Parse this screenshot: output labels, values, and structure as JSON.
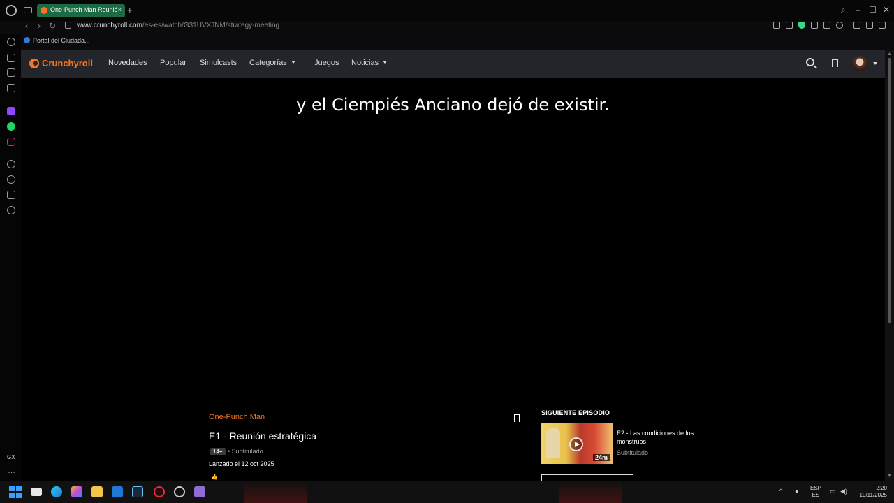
{
  "browser": {
    "tab": {
      "title": "One-Punch Man Reunión"
    },
    "address": {
      "host": "www.crunchyroll.com",
      "path": "/es-es/watch/G31UVXJNM/strategy-meeting"
    },
    "bookmarks": [
      {
        "label": "Portal del Ciudada..."
      }
    ],
    "sidebar": {
      "gx_label": "GX",
      "more_label": "…"
    }
  },
  "site": {
    "logo": "Crunchyroll",
    "brand_color": "#f47521",
    "nav": [
      {
        "label": "Novedades"
      },
      {
        "label": "Popular"
      },
      {
        "label": "Simulcasts"
      },
      {
        "label": "Categorías"
      },
      {
        "label": "Juegos"
      },
      {
        "label": "Noticias"
      }
    ]
  },
  "player": {
    "subtitle": "y el Ciempiés Anciano dejó de existir."
  },
  "episode": {
    "series": "One-Punch Man",
    "title": "E1 - Reunión estratégica",
    "rating": "14+",
    "audio": "• Subtitulado",
    "release": "Lanzado el 12 oct 2025"
  },
  "next_episode": {
    "label": "SIGUIENTE EPISODIO",
    "title": "E2 - Las condiciones de los monstruos",
    "audio": "Subtitulado",
    "duration": "24m"
  },
  "taskbar": {
    "lang_line1": "ESP",
    "lang_line2": "ES",
    "time": "2:20",
    "date": "10/11/2025"
  }
}
